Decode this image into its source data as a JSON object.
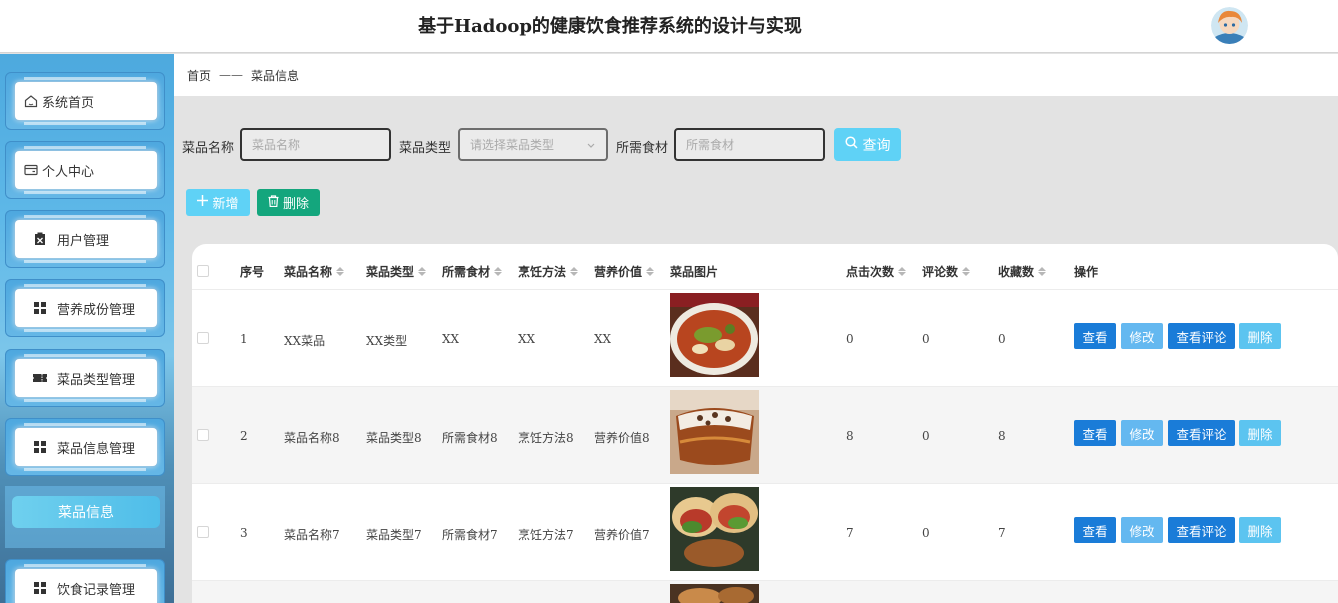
{
  "header": {
    "title": "基于Hadoop的健康饮食推荐系统的设计与实现"
  },
  "sidebar": {
    "items": [
      {
        "label": "系统首页",
        "icon": "home-icon"
      },
      {
        "label": "个人中心",
        "icon": "wallet-icon"
      },
      {
        "label": "用户管理",
        "icon": "clipboard-icon"
      },
      {
        "label": "营养成份管理",
        "icon": "grid-icon"
      },
      {
        "label": "菜品类型管理",
        "icon": "ticket-icon"
      },
      {
        "label": "菜品信息管理",
        "icon": "grid-icon"
      },
      {
        "label": "饮食记录管理",
        "icon": "grid-icon"
      }
    ],
    "active_sub": "菜品信息"
  },
  "breadcrumb": {
    "home": "首页",
    "separator": "——",
    "current": "菜品信息"
  },
  "search": {
    "name_label": "菜品名称",
    "name_placeholder": "菜品名称",
    "type_label": "菜品类型",
    "type_placeholder": "请选择菜品类型",
    "ingredient_label": "所需食材",
    "ingredient_placeholder": "所需食材",
    "query_label": "查询"
  },
  "toolbar": {
    "add_label": "新增",
    "delete_label": "删除"
  },
  "table": {
    "headers": {
      "index": "序号",
      "name": "菜品名称",
      "type": "菜品类型",
      "ingredient": "所需食材",
      "method": "烹饪方法",
      "nutrition": "营养价值",
      "image": "菜品图片",
      "clicks": "点击次数",
      "comments": "评论数",
      "favorites": "收藏数",
      "actions": "操作"
    },
    "rows": [
      {
        "index": "1",
        "name": "XX菜品",
        "type": "XX类型",
        "ingredient": "XX",
        "method": "XX",
        "nutrition": "XX",
        "clicks": "0",
        "comments": "0",
        "favorites": "0"
      },
      {
        "index": "2",
        "name": "菜品名称8",
        "type": "菜品类型8",
        "ingredient": "所需食材8",
        "method": "烹饪方法8",
        "nutrition": "营养价值8",
        "clicks": "8",
        "comments": "0",
        "favorites": "8"
      },
      {
        "index": "3",
        "name": "菜品名称7",
        "type": "菜品类型7",
        "ingredient": "所需食材7",
        "method": "烹饪方法7",
        "nutrition": "营养价值7",
        "clicks": "7",
        "comments": "0",
        "favorites": "7"
      }
    ],
    "actions": {
      "view": "查看",
      "edit": "修改",
      "comments": "查看评论",
      "delete": "删除"
    }
  },
  "colors": {
    "accent": "#5fd2f6",
    "primary": "#1a7cd8",
    "danger_green": "#14a67d"
  }
}
